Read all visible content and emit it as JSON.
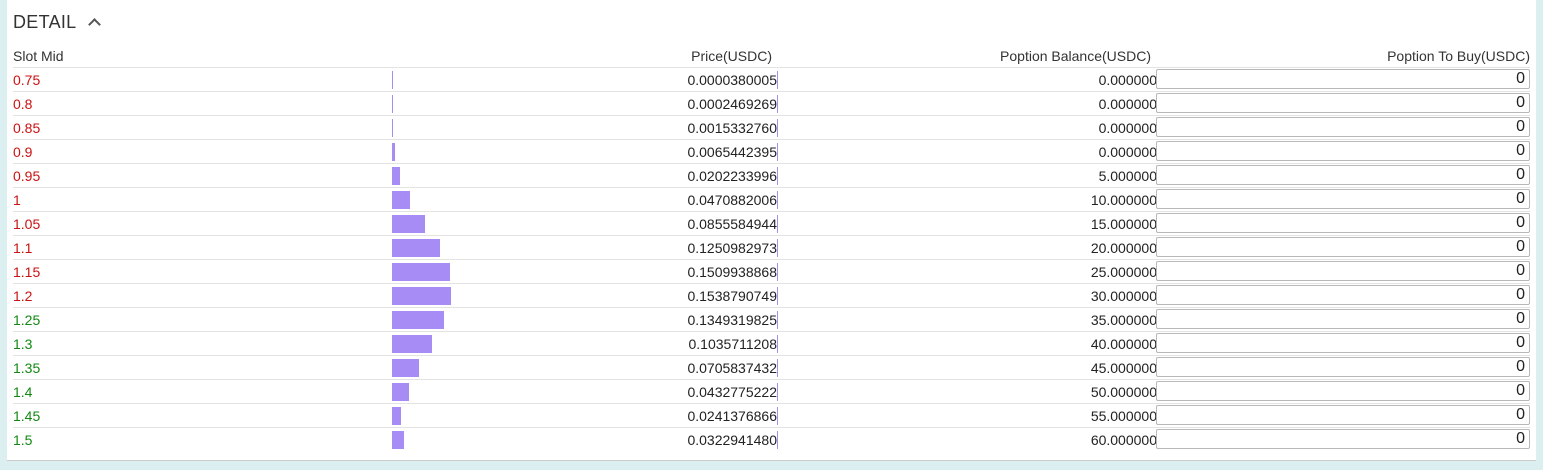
{
  "header": {
    "title": "DETAIL"
  },
  "columns": {
    "slot_mid": "Slot Mid",
    "price": "Price(USDC)",
    "balance": "Poption Balance(USDC)",
    "to_buy": "Poption To Buy(USDC)"
  },
  "colors": {
    "red": "#cc1111",
    "green": "#118811",
    "bar": "#a88cf5"
  },
  "rows": [
    {
      "slot": "0.75",
      "price": "0.0000380005",
      "balance": "0.000000",
      "buy": "0",
      "tone": "red"
    },
    {
      "slot": "0.8",
      "price": "0.0002469269",
      "balance": "0.000000",
      "buy": "0",
      "tone": "red"
    },
    {
      "slot": "0.85",
      "price": "0.0015332760",
      "balance": "0.000000",
      "buy": "0",
      "tone": "red"
    },
    {
      "slot": "0.9",
      "price": "0.0065442395",
      "balance": "0.000000",
      "buy": "0",
      "tone": "red"
    },
    {
      "slot": "0.95",
      "price": "0.0202233996",
      "balance": "5.000000",
      "buy": "0",
      "tone": "red"
    },
    {
      "slot": "1",
      "price": "0.0470882006",
      "balance": "10.000000",
      "buy": "0",
      "tone": "red"
    },
    {
      "slot": "1.05",
      "price": "0.0855584944",
      "balance": "15.000000",
      "buy": "0",
      "tone": "red"
    },
    {
      "slot": "1.1",
      "price": "0.1250982973",
      "balance": "20.000000",
      "buy": "0",
      "tone": "red"
    },
    {
      "slot": "1.15",
      "price": "0.1509938868",
      "balance": "25.000000",
      "buy": "0",
      "tone": "red"
    },
    {
      "slot": "1.2",
      "price": "0.1538790749",
      "balance": "30.000000",
      "buy": "0",
      "tone": "red"
    },
    {
      "slot": "1.25",
      "price": "0.1349319825",
      "balance": "35.000000",
      "buy": "0",
      "tone": "green"
    },
    {
      "slot": "1.3",
      "price": "0.1035711208",
      "balance": "40.000000",
      "buy": "0",
      "tone": "green"
    },
    {
      "slot": "1.35",
      "price": "0.0705837432",
      "balance": "45.000000",
      "buy": "0",
      "tone": "green"
    },
    {
      "slot": "1.4",
      "price": "0.0432775222",
      "balance": "50.000000",
      "buy": "0",
      "tone": "green"
    },
    {
      "slot": "1.45",
      "price": "0.0241376866",
      "balance": "55.000000",
      "buy": "0",
      "tone": "green"
    },
    {
      "slot": "1.5",
      "price": "0.0322941480",
      "balance": "60.000000",
      "buy": "0",
      "tone": "green"
    }
  ]
}
